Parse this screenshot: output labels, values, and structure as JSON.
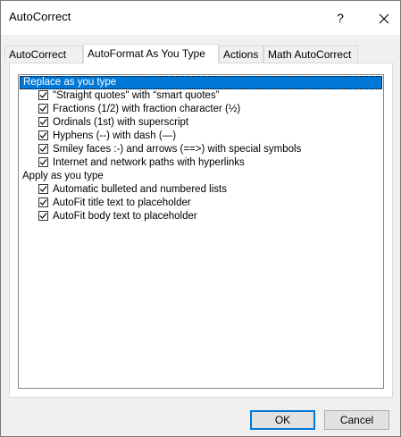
{
  "window": {
    "title": "AutoCorrect",
    "help_label": "?",
    "close_icon": "close-icon"
  },
  "tabs": [
    {
      "label": "AutoCorrect",
      "active": false
    },
    {
      "label": "AutoFormat As You Type",
      "active": true
    },
    {
      "label": "Actions",
      "active": false
    },
    {
      "label": "Math AutoCorrect",
      "active": false
    }
  ],
  "list": {
    "replace_header": "Replace as you type",
    "replace_items": [
      {
        "label": "\"Straight quotes\" with “smart quotes”",
        "checked": true
      },
      {
        "label": "Fractions (1/2) with fraction character (½)",
        "checked": true
      },
      {
        "label": "Ordinals (1st) with superscript",
        "checked": true
      },
      {
        "label": "Hyphens (--) with dash (—)",
        "checked": true
      },
      {
        "label": "Smiley faces :-) and arrows (==>) with special symbols",
        "checked": true
      },
      {
        "label": "Internet and network paths with hyperlinks",
        "checked": true
      }
    ],
    "apply_header": "Apply as you type",
    "apply_items": [
      {
        "label": "Automatic bulleted and numbered lists",
        "checked": true
      },
      {
        "label": "AutoFit title text to placeholder",
        "checked": true
      },
      {
        "label": "AutoFit body text to placeholder",
        "checked": true
      }
    ]
  },
  "buttons": {
    "ok_label": "OK",
    "cancel_label": "Cancel"
  },
  "colors": {
    "selection": "#0078d7",
    "dialog_bg": "#f0f0f0"
  }
}
